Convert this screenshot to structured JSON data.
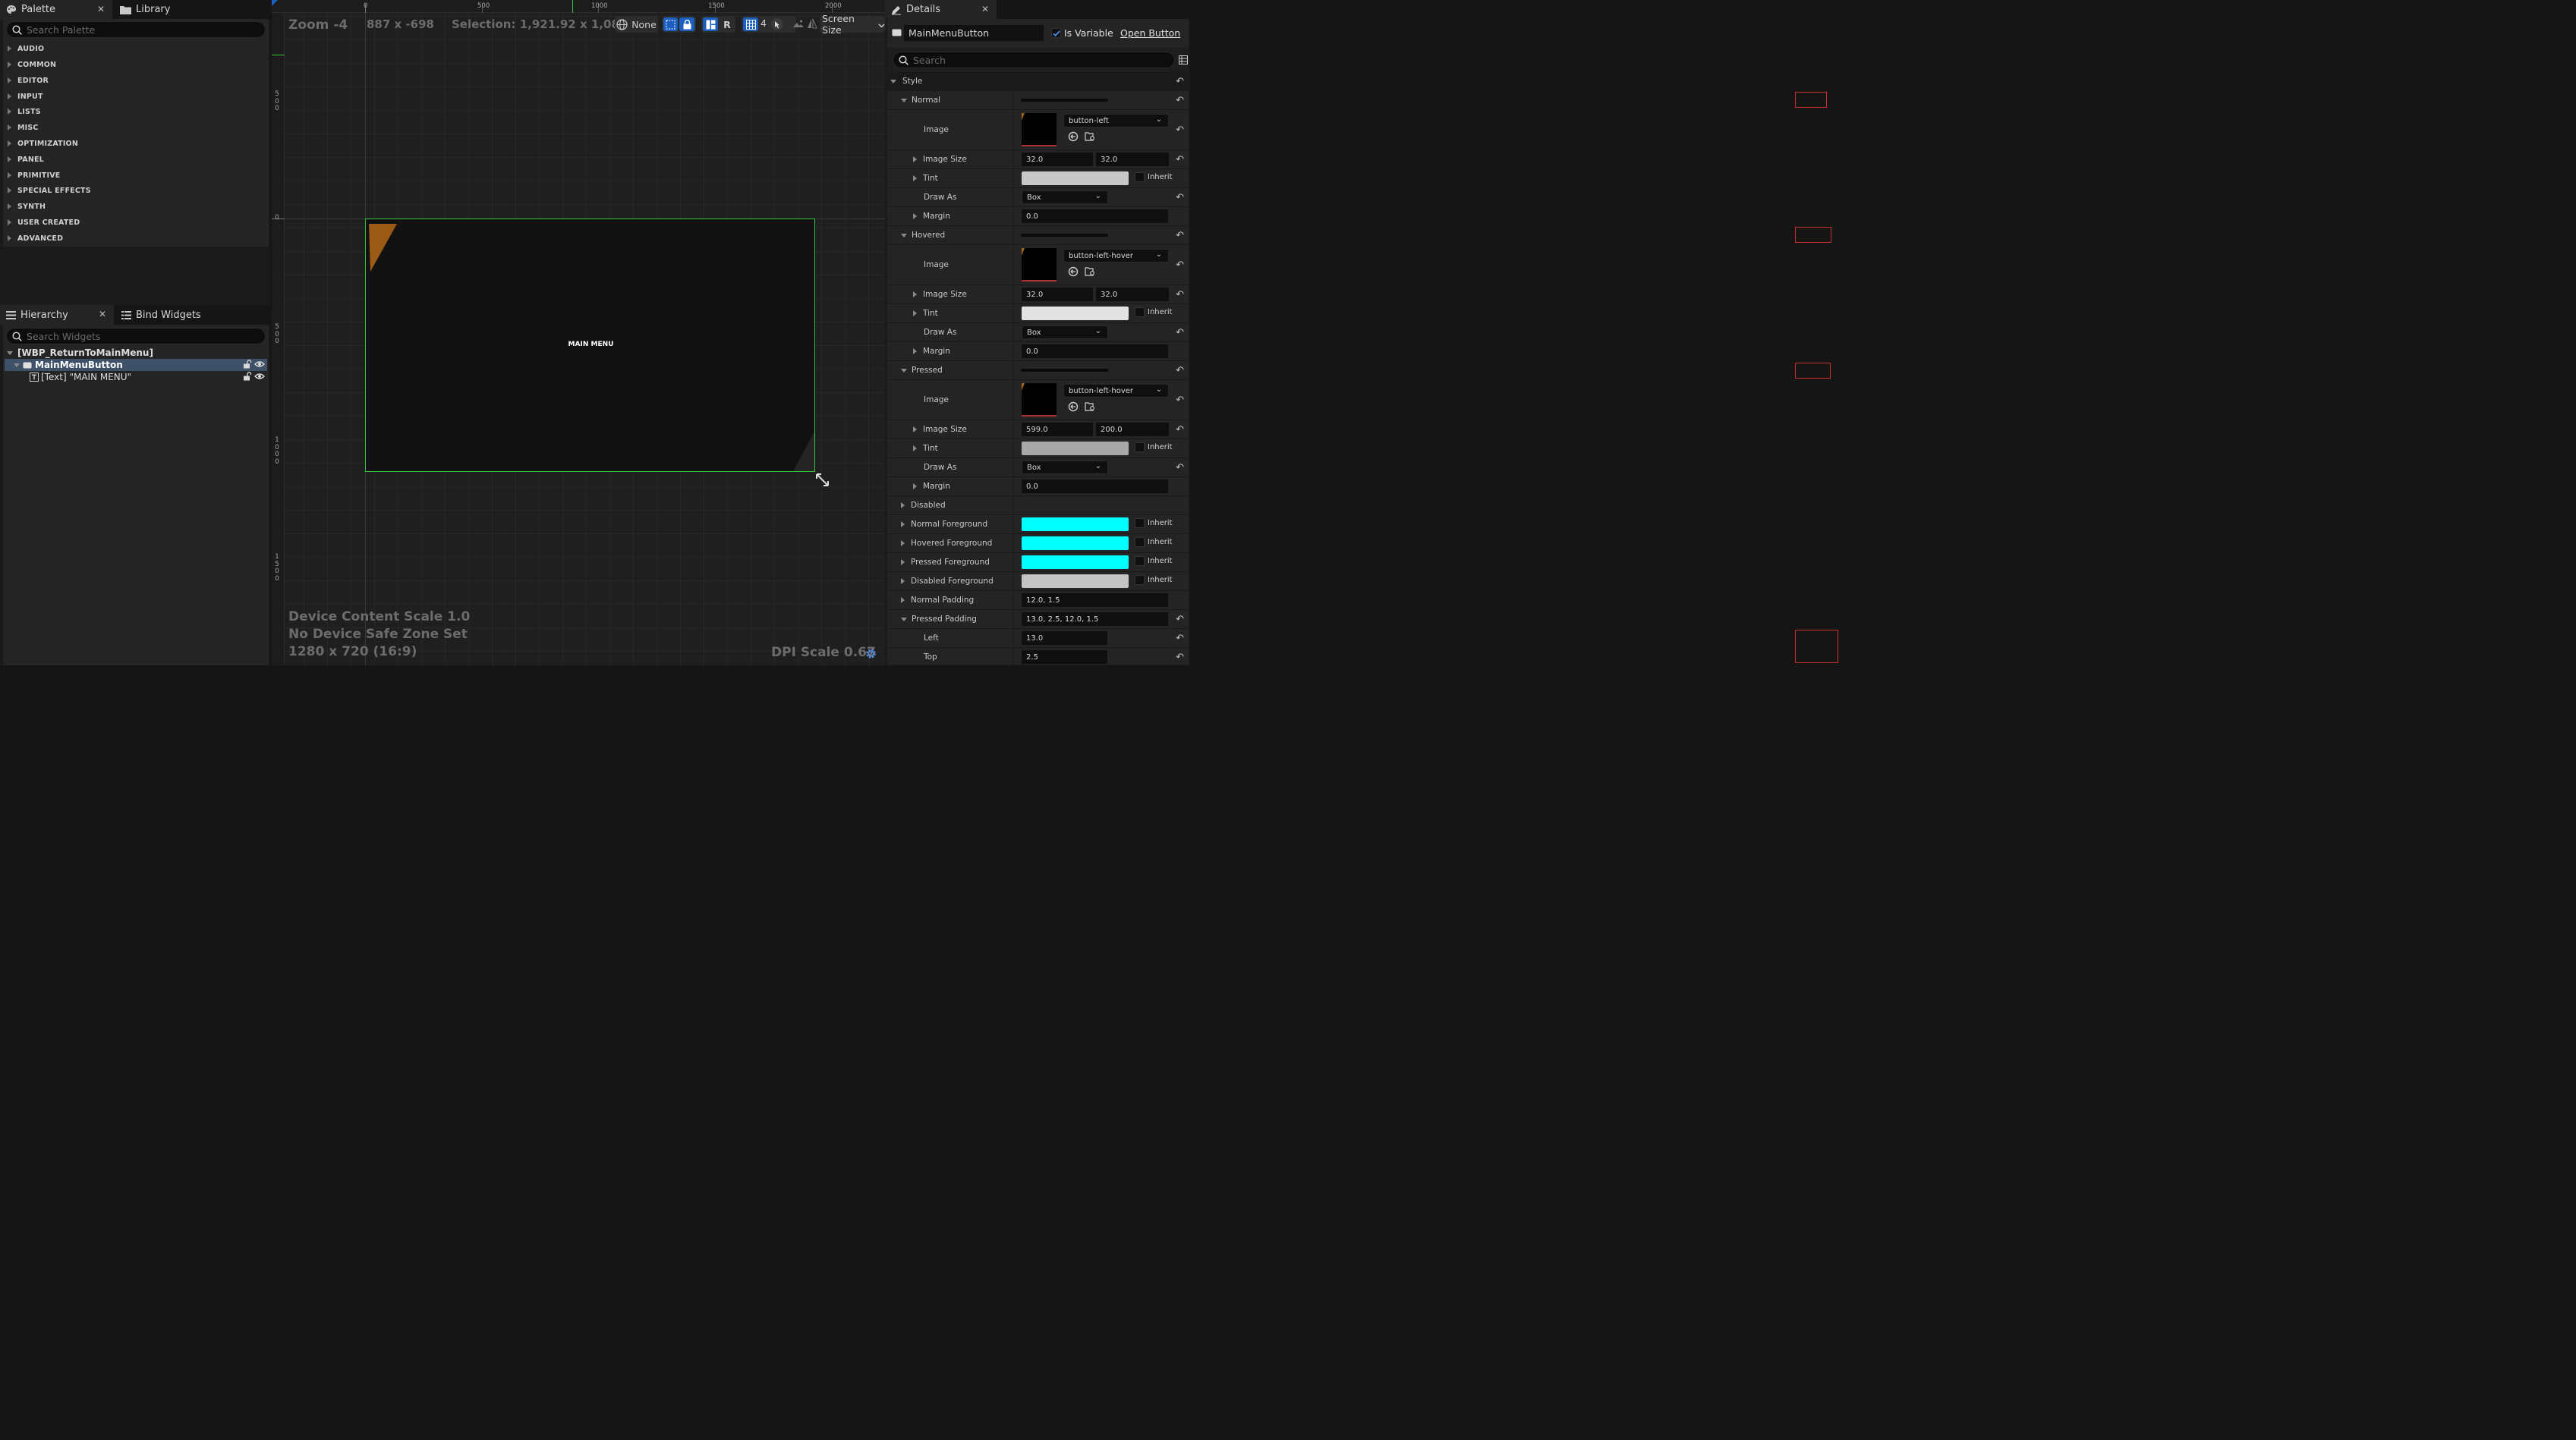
{
  "palette": {
    "tab_label": "Palette",
    "library_tab_label": "Library",
    "search_placeholder": "Search Palette",
    "categories": [
      "AUDIO",
      "COMMON",
      "EDITOR",
      "INPUT",
      "LISTS",
      "MISC",
      "OPTIMIZATION",
      "PANEL",
      "PRIMITIVE",
      "SPECIAL EFFECTS",
      "SYNTH",
      "USER CREATED",
      "ADVANCED"
    ]
  },
  "hierarchy": {
    "tab_label": "Hierarchy",
    "bind_tab_label": "Bind Widgets",
    "search_placeholder": "Search Widgets",
    "root": "[WBP_ReturnToMainMenu]",
    "selected": "MainMenuButton",
    "child": "[Text] \"MAIN MENU\""
  },
  "canvas": {
    "zoom": "Zoom -4",
    "size": "887 x -698",
    "selection": "Selection: 1,921.92 x 1,081.08",
    "locale": "None",
    "r_label": "R",
    "grid_value": "4",
    "screen_size": "Screen Size",
    "ruler_top": [
      "0",
      "500",
      "1000",
      "1500",
      "2000"
    ],
    "ruler_left": [
      "500",
      "0",
      "500",
      "1000",
      "1500"
    ],
    "button_text": "MAIN MENU",
    "device_scale": "Device Content Scale 1.0",
    "safe_zone": "No Device Safe Zone Set",
    "resolution": "1280 x 720 (16:9)",
    "dpi_scale": "DPI Scale 0.67"
  },
  "details": {
    "tab_label": "Details",
    "widget_name": "MainMenuButton",
    "is_variable_label": "Is Variable",
    "open_button_label": "Open Button",
    "search_placeholder": "Search",
    "style_label": "Style",
    "normal": {
      "label": "Normal",
      "image_label": "Image",
      "image_name": "button-left",
      "size_label": "Image Size",
      "size_x": "32.0",
      "size_y": "32.0",
      "tint_label": "Tint",
      "draw_as_label": "Draw As",
      "draw_as": "Box",
      "margin_label": "Margin",
      "margin": "0.0"
    },
    "hovered": {
      "label": "Hovered",
      "image_label": "Image",
      "image_name": "button-left-hover",
      "size_label": "Image Size",
      "size_x": "32.0",
      "size_y": "32.0",
      "tint_label": "Tint",
      "draw_as_label": "Draw As",
      "draw_as": "Box",
      "margin_label": "Margin",
      "margin": "0.0"
    },
    "pressed": {
      "label": "Pressed",
      "image_label": "Image",
      "image_name": "button-left-hover",
      "size_label": "Image Size",
      "size_x": "599.0",
      "size_y": "200.0",
      "tint_label": "Tint",
      "draw_as_label": "Draw As",
      "draw_as": "Box",
      "margin_label": "Margin",
      "margin": "0.0"
    },
    "inherit_label": "Inherit",
    "disabled_label": "Disabled",
    "normal_fg_label": "Normal Foreground",
    "hovered_fg_label": "Hovered Foreground",
    "pressed_fg_label": "Pressed Foreground",
    "disabled_fg_label": "Disabled Foreground",
    "normal_padding_label": "Normal Padding",
    "normal_padding": "12.0, 1.5",
    "pressed_padding_label": "Pressed Padding",
    "pressed_padding": "13.0, 2.5, 12.0, 1.5",
    "left_label": "Left",
    "left_value": "13.0",
    "top_label": "Top",
    "top_value": "2.5"
  },
  "colors": {
    "accent_blue": "#1c5fc0",
    "selection_green": "#3ac03a",
    "foreground_cyan": "#00ffff",
    "highlight_red": "#c83030",
    "corner_orange": "#9a5a16"
  }
}
